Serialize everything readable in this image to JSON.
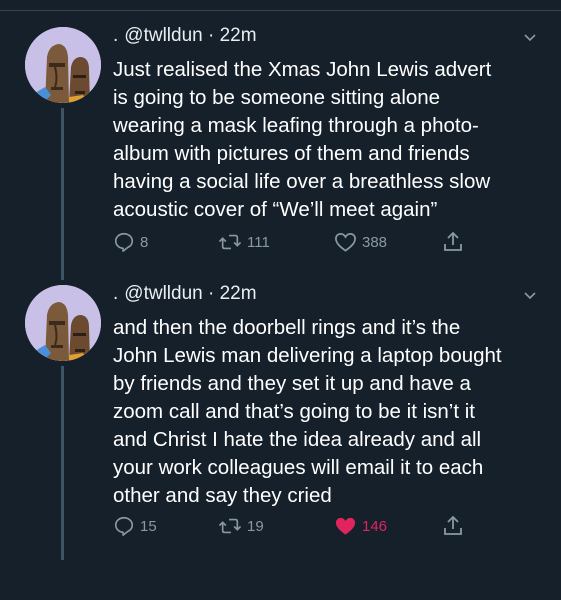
{
  "tweets": [
    {
      "lead": ".",
      "handle": "@twlldun",
      "separator": "·",
      "time": "22m",
      "lines": [
        "Just realised the Xmas John Lewis advert",
        "is going to be someone sitting alone",
        "wearing a mask leafing through a photo-",
        "album with pictures of them and friends",
        "having a social life over a breathless slow",
        "acoustic cover of “We’ll meet again”"
      ],
      "replies": "8",
      "retweets": "111",
      "likes": "388",
      "liked": false
    },
    {
      "lead": ".",
      "handle": "@twlldun",
      "separator": "·",
      "time": "22m",
      "lines": [
        "and then the doorbell rings and it’s the",
        "John Lewis man delivering a laptop bought",
        "by friends and they set it up and have a",
        "zoom call and that’s going to be it isn’t it",
        "and Christ I hate the idea already and all",
        "your work colleagues will email it to each",
        "other and say they cried"
      ],
      "replies": "15",
      "retweets": "19",
      "likes": "146",
      "liked": true
    }
  ],
  "icons": {
    "reply": "reply-icon",
    "retweet": "retweet-icon",
    "like": "heart-icon",
    "share": "share-icon",
    "menu": "chevron-down-icon"
  },
  "colors": {
    "background": "#15202b",
    "muted": "#8899a6",
    "like_active": "#e0245e",
    "text": "#ffffff"
  }
}
